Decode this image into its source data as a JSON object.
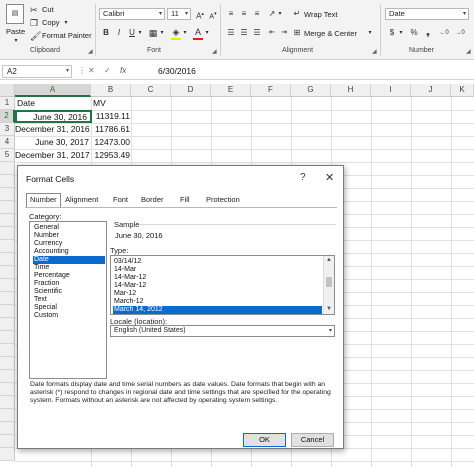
{
  "ribbon": {
    "clipboard": {
      "paste_label": "Paste",
      "cut_label": "Cut",
      "copy_label": "Copy",
      "format_painter_label": "Format Painter",
      "group_label": "Clipboard"
    },
    "font": {
      "font_name": "Calibri",
      "font_size": "11",
      "bold": "B",
      "italic": "I",
      "underline": "U",
      "group_label": "Font"
    },
    "alignment": {
      "wrap_text_label": "Wrap Text",
      "merge_center_label": "Merge & Center",
      "group_label": "Alignment"
    },
    "number": {
      "format_value": "Date",
      "currency": "$",
      "percent": "%",
      "group_label": "Number"
    }
  },
  "formula_bar": {
    "name_box": "A2",
    "fx": "fx",
    "formula": "6/30/2016"
  },
  "sheet": {
    "columns": [
      "A",
      "B",
      "C",
      "D",
      "E",
      "F",
      "G",
      "H",
      "I",
      "J",
      "K"
    ],
    "rows": [
      "1",
      "2",
      "3",
      "4",
      "5"
    ],
    "cells": {
      "a1": "Date",
      "b1": "MV",
      "a2": "June 30, 2016",
      "b2": "11319.11",
      "a3": "December 31, 2016",
      "b3": "11786.61",
      "a4": "June 30, 2017",
      "b4": "12473.00",
      "a5": "December 31, 2017",
      "b5": "12953.49"
    }
  },
  "dialog": {
    "title": "Format Cells",
    "help": "?",
    "close": "✕",
    "tabs": [
      "Number",
      "Alignment",
      "Font",
      "Border",
      "Fill",
      "Protection"
    ],
    "category_label": "Category:",
    "categories": [
      "General",
      "Number",
      "Currency",
      "Accounting",
      "Date",
      "Time",
      "Percentage",
      "Fraction",
      "Scientific",
      "Text",
      "Special",
      "Custom"
    ],
    "sample_label": "Sample",
    "sample_value": "June 30, 2016",
    "type_label": "Type:",
    "types": [
      "03/14/12",
      "14-Mar",
      "14-Mar-12",
      "14-Mar-12",
      "Mar-12",
      "March-12",
      "March 14, 2012"
    ],
    "locale_label": "Locale (location):",
    "locale_value": "English (United States)",
    "description": "Date formats display date and time serial numbers as date values.  Date formats that begin with an asterisk (*) respond to changes in regional date and time settings that are specified for the operating system. Formats without an asterisk are not affected by operating system settings.",
    "ok_label": "OK",
    "cancel_label": "Cancel"
  },
  "colors": {
    "selection": "#0a6ad0",
    "ribbon_bg": "#f3f3f3",
    "font_color_red": "#e81c1c",
    "highlight_yellow": "#f6e300",
    "header_bg": "#f0f0f0"
  }
}
